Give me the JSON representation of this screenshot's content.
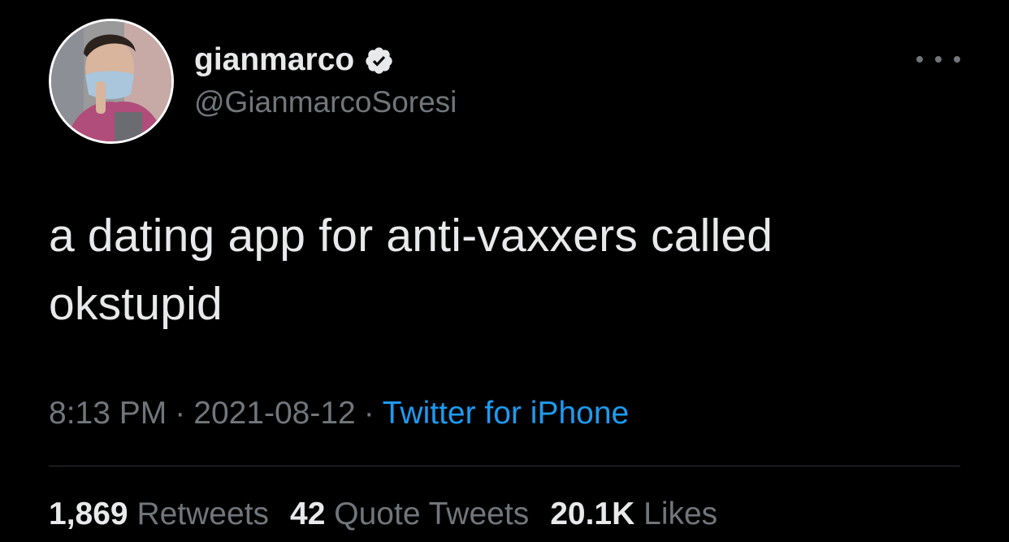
{
  "user": {
    "display_name": "gianmarco",
    "handle": "@GianmarcoSoresi",
    "verified": true
  },
  "tweet": {
    "text_line1": "a dating app for anti-vaxxers called",
    "text_line2": "okstupid",
    "time": "8:13 PM",
    "separator": "·",
    "date": "2021-08-12",
    "source": "Twitter for iPhone"
  },
  "stats": {
    "retweets_count": "1,869",
    "retweets_label": "Retweets",
    "quotes_count": "42",
    "quotes_label": "Quote Tweets",
    "likes_count": "20.1K",
    "likes_label": "Likes"
  },
  "icons": {
    "verified": "verified-badge-icon",
    "more": "more-options-icon"
  },
  "colors": {
    "background": "#000000",
    "text_primary": "#e7e9ea",
    "text_secondary": "#71767b",
    "link": "#1d9bf0",
    "divider": "#2f3336"
  }
}
